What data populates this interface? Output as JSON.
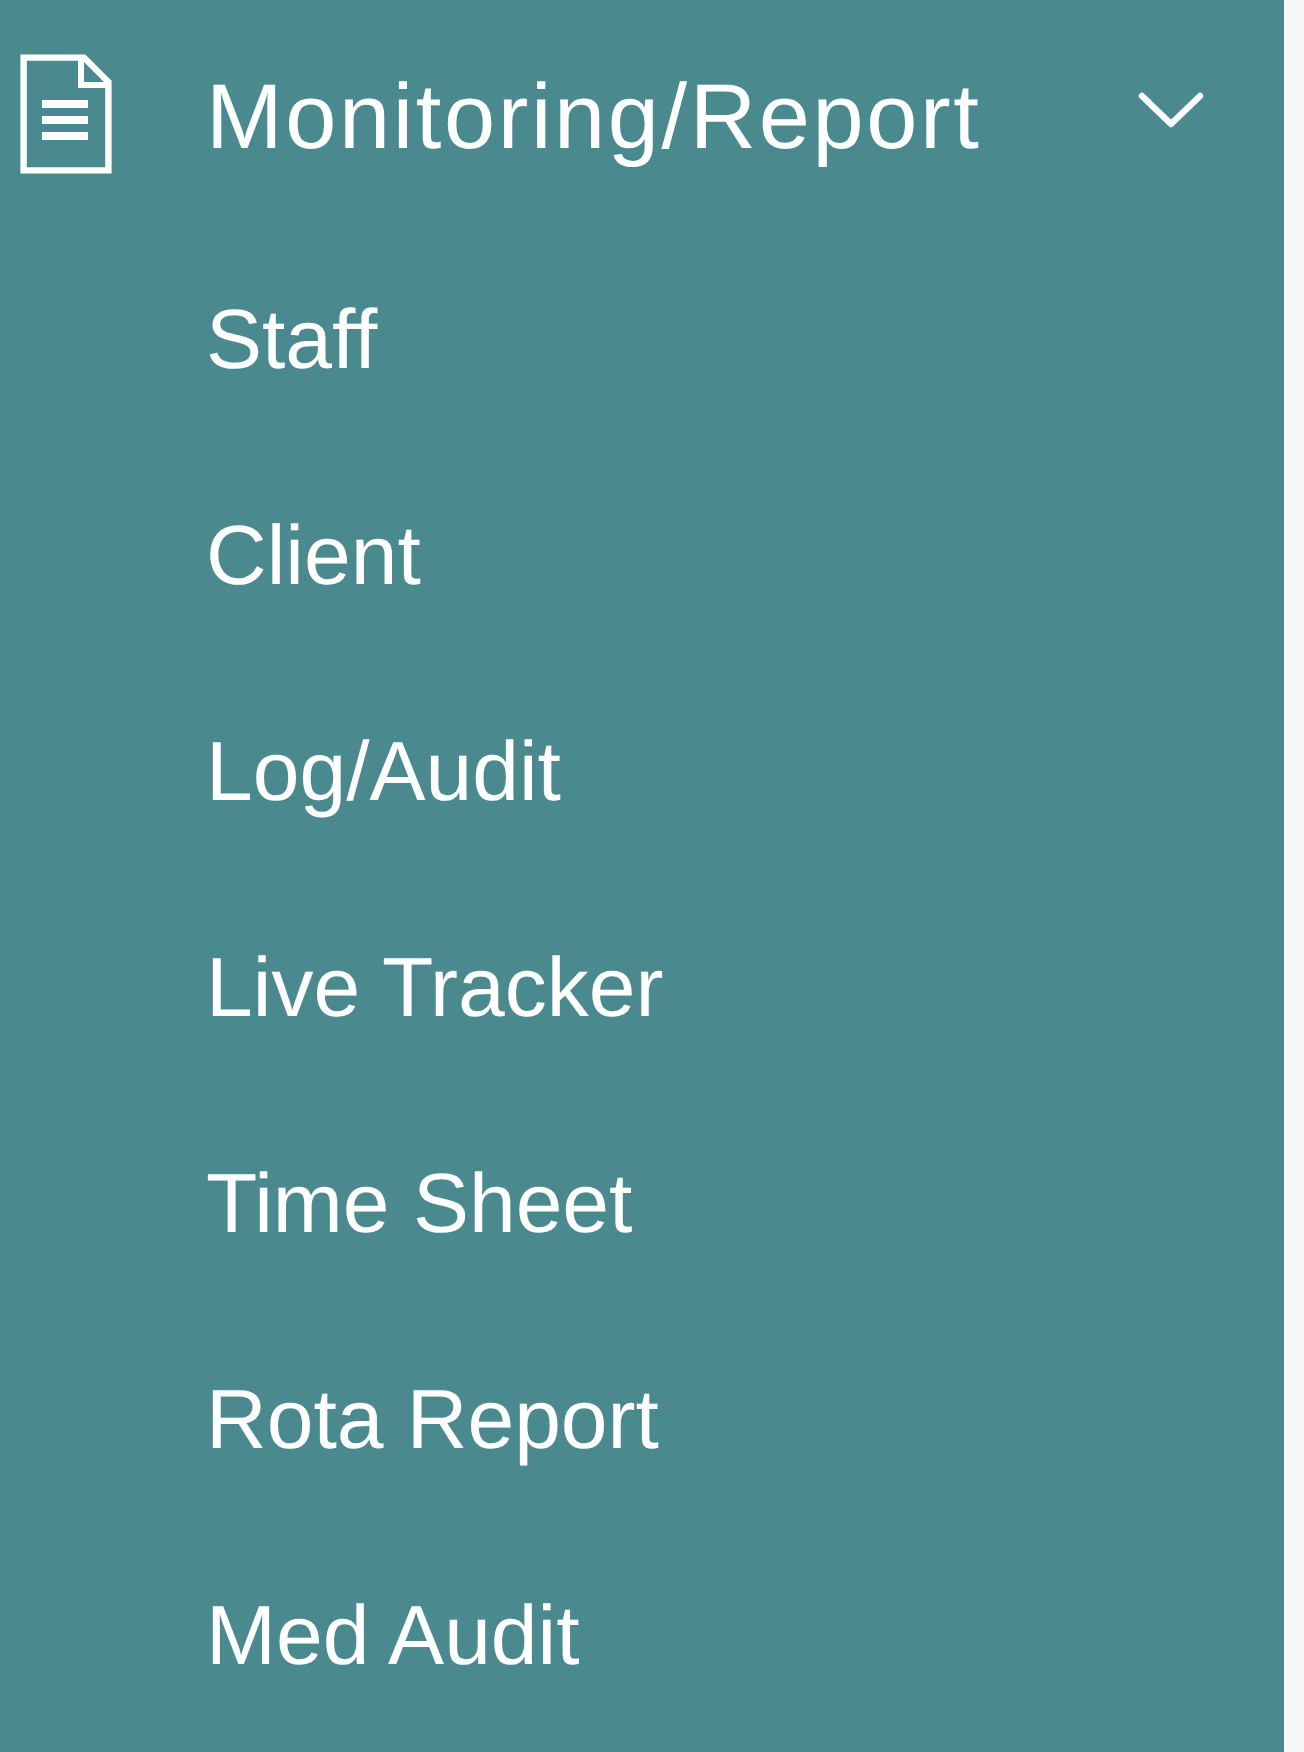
{
  "sidebar": {
    "section": {
      "title": "Monitoring/Report",
      "expanded": true,
      "items": [
        {
          "label": "Staff"
        },
        {
          "label": "Client"
        },
        {
          "label": "Log/Audit"
        },
        {
          "label": "Live Tracker"
        },
        {
          "label": "Time Sheet"
        },
        {
          "label": "Rota Report"
        },
        {
          "label": "Med Audit"
        }
      ]
    }
  }
}
